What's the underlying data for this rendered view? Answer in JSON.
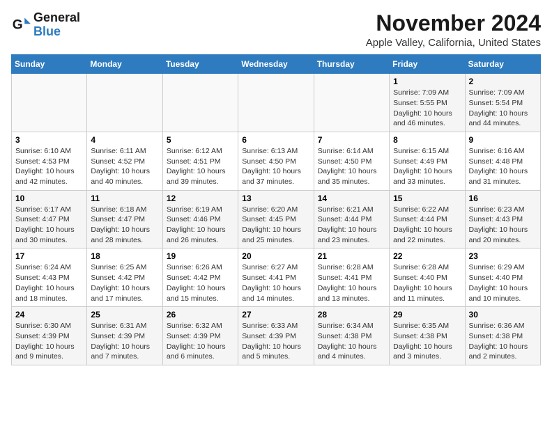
{
  "logo": {
    "text_general": "General",
    "text_blue": "Blue"
  },
  "title": "November 2024",
  "location": "Apple Valley, California, United States",
  "days_header": [
    "Sunday",
    "Monday",
    "Tuesday",
    "Wednesday",
    "Thursday",
    "Friday",
    "Saturday"
  ],
  "weeks": [
    [
      {
        "day": "",
        "info": ""
      },
      {
        "day": "",
        "info": ""
      },
      {
        "day": "",
        "info": ""
      },
      {
        "day": "",
        "info": ""
      },
      {
        "day": "",
        "info": ""
      },
      {
        "day": "1",
        "info": "Sunrise: 7:09 AM\nSunset: 5:55 PM\nDaylight: 10 hours and 46 minutes."
      },
      {
        "day": "2",
        "info": "Sunrise: 7:09 AM\nSunset: 5:54 PM\nDaylight: 10 hours and 44 minutes."
      }
    ],
    [
      {
        "day": "3",
        "info": "Sunrise: 6:10 AM\nSunset: 4:53 PM\nDaylight: 10 hours and 42 minutes."
      },
      {
        "day": "4",
        "info": "Sunrise: 6:11 AM\nSunset: 4:52 PM\nDaylight: 10 hours and 40 minutes."
      },
      {
        "day": "5",
        "info": "Sunrise: 6:12 AM\nSunset: 4:51 PM\nDaylight: 10 hours and 39 minutes."
      },
      {
        "day": "6",
        "info": "Sunrise: 6:13 AM\nSunset: 4:50 PM\nDaylight: 10 hours and 37 minutes."
      },
      {
        "day": "7",
        "info": "Sunrise: 6:14 AM\nSunset: 4:50 PM\nDaylight: 10 hours and 35 minutes."
      },
      {
        "day": "8",
        "info": "Sunrise: 6:15 AM\nSunset: 4:49 PM\nDaylight: 10 hours and 33 minutes."
      },
      {
        "day": "9",
        "info": "Sunrise: 6:16 AM\nSunset: 4:48 PM\nDaylight: 10 hours and 31 minutes."
      }
    ],
    [
      {
        "day": "10",
        "info": "Sunrise: 6:17 AM\nSunset: 4:47 PM\nDaylight: 10 hours and 30 minutes."
      },
      {
        "day": "11",
        "info": "Sunrise: 6:18 AM\nSunset: 4:47 PM\nDaylight: 10 hours and 28 minutes."
      },
      {
        "day": "12",
        "info": "Sunrise: 6:19 AM\nSunset: 4:46 PM\nDaylight: 10 hours and 26 minutes."
      },
      {
        "day": "13",
        "info": "Sunrise: 6:20 AM\nSunset: 4:45 PM\nDaylight: 10 hours and 25 minutes."
      },
      {
        "day": "14",
        "info": "Sunrise: 6:21 AM\nSunset: 4:44 PM\nDaylight: 10 hours and 23 minutes."
      },
      {
        "day": "15",
        "info": "Sunrise: 6:22 AM\nSunset: 4:44 PM\nDaylight: 10 hours and 22 minutes."
      },
      {
        "day": "16",
        "info": "Sunrise: 6:23 AM\nSunset: 4:43 PM\nDaylight: 10 hours and 20 minutes."
      }
    ],
    [
      {
        "day": "17",
        "info": "Sunrise: 6:24 AM\nSunset: 4:43 PM\nDaylight: 10 hours and 18 minutes."
      },
      {
        "day": "18",
        "info": "Sunrise: 6:25 AM\nSunset: 4:42 PM\nDaylight: 10 hours and 17 minutes."
      },
      {
        "day": "19",
        "info": "Sunrise: 6:26 AM\nSunset: 4:42 PM\nDaylight: 10 hours and 15 minutes."
      },
      {
        "day": "20",
        "info": "Sunrise: 6:27 AM\nSunset: 4:41 PM\nDaylight: 10 hours and 14 minutes."
      },
      {
        "day": "21",
        "info": "Sunrise: 6:28 AM\nSunset: 4:41 PM\nDaylight: 10 hours and 13 minutes."
      },
      {
        "day": "22",
        "info": "Sunrise: 6:28 AM\nSunset: 4:40 PM\nDaylight: 10 hours and 11 minutes."
      },
      {
        "day": "23",
        "info": "Sunrise: 6:29 AM\nSunset: 4:40 PM\nDaylight: 10 hours and 10 minutes."
      }
    ],
    [
      {
        "day": "24",
        "info": "Sunrise: 6:30 AM\nSunset: 4:39 PM\nDaylight: 10 hours and 9 minutes."
      },
      {
        "day": "25",
        "info": "Sunrise: 6:31 AM\nSunset: 4:39 PM\nDaylight: 10 hours and 7 minutes."
      },
      {
        "day": "26",
        "info": "Sunrise: 6:32 AM\nSunset: 4:39 PM\nDaylight: 10 hours and 6 minutes."
      },
      {
        "day": "27",
        "info": "Sunrise: 6:33 AM\nSunset: 4:39 PM\nDaylight: 10 hours and 5 minutes."
      },
      {
        "day": "28",
        "info": "Sunrise: 6:34 AM\nSunset: 4:38 PM\nDaylight: 10 hours and 4 minutes."
      },
      {
        "day": "29",
        "info": "Sunrise: 6:35 AM\nSunset: 4:38 PM\nDaylight: 10 hours and 3 minutes."
      },
      {
        "day": "30",
        "info": "Sunrise: 6:36 AM\nSunset: 4:38 PM\nDaylight: 10 hours and 2 minutes."
      }
    ]
  ]
}
